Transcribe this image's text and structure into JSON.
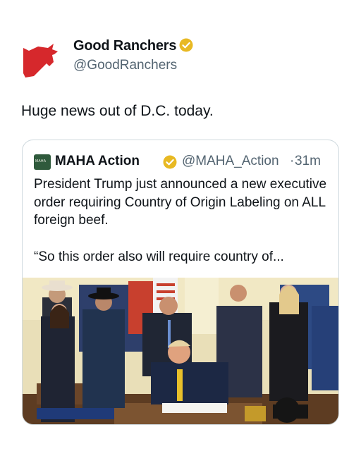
{
  "post": {
    "author_name": "Good Ranchers",
    "author_handle": "@GoodRanchers",
    "text": "Huge news out of D.C. today."
  },
  "quote": {
    "avatar_text": "MAHA",
    "author_name": "MAHA Action",
    "author_handle": "@MAHA_Action",
    "separator": "·",
    "time": "31m",
    "text_line1": "President Trump just announced a new executive order requiring Country of Origin Labeling on ALL foreign beef.",
    "text_line2": "“So this order also will require country of..."
  },
  "colors": {
    "logo_red": "#d6282c",
    "verified_gold": "#e8b923",
    "muted_text": "#536471",
    "card_border": "#cfd9de"
  },
  "icons": {
    "logo": "bull-head-icon",
    "verified": "verified-badge-icon"
  }
}
